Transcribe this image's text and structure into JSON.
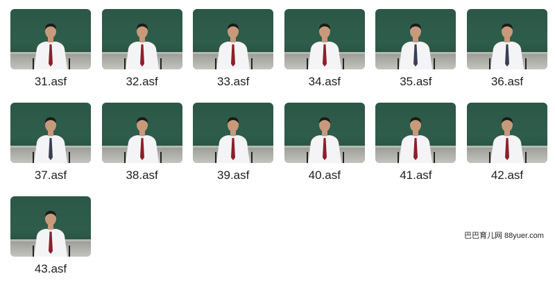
{
  "files": [
    {
      "name": "31.asf",
      "tie": "#8e1f2a"
    },
    {
      "name": "32.asf",
      "tie": "#8e1f2a"
    },
    {
      "name": "33.asf",
      "tie": "#8e1f2a"
    },
    {
      "name": "34.asf",
      "tie": "#8e1f2a"
    },
    {
      "name": "35.asf",
      "tie": "#3b3f55"
    },
    {
      "name": "36.asf",
      "tie": "#3b3f55"
    },
    {
      "name": "37.asf",
      "tie": "#3b3f55"
    },
    {
      "name": "38.asf",
      "tie": "#8e1f2a"
    },
    {
      "name": "39.asf",
      "tie": "#8e1f2a"
    },
    {
      "name": "40.asf",
      "tie": "#8e1f2a"
    },
    {
      "name": "41.asf",
      "tie": "#8e1f2a"
    },
    {
      "name": "42.asf",
      "tie": "#8e1f2a"
    },
    {
      "name": "43.asf",
      "tie": "#8e1f2a"
    }
  ],
  "watermark": "巴巴育儿网 88yuer.com",
  "colors": {
    "board": "#2f5d4b",
    "shirt": "#f4f4f6",
    "skin": "#c79a7c",
    "hair": "#1a1a1a"
  }
}
